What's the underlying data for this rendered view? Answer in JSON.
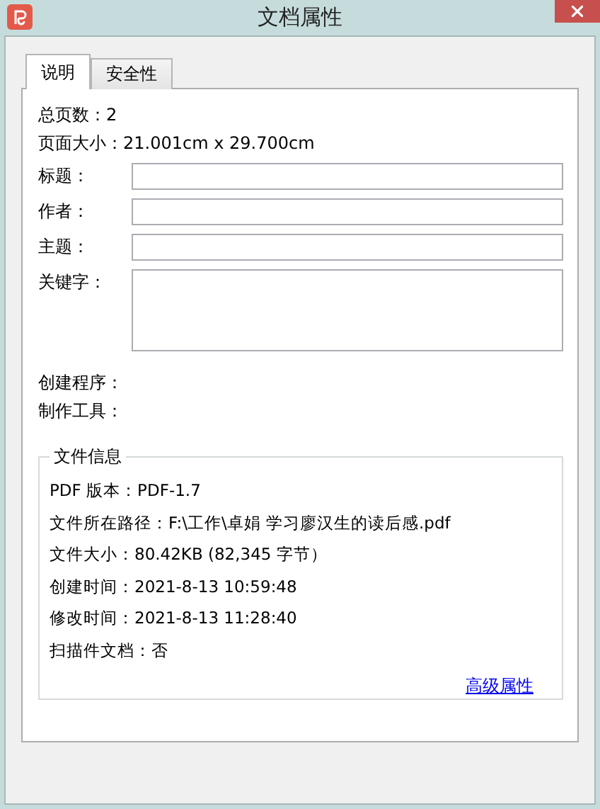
{
  "window": {
    "title": "文档属性"
  },
  "tabs": [
    {
      "label": "说明",
      "selected": true
    },
    {
      "label": "安全性",
      "selected": false
    }
  ],
  "summary": [
    "总页数：2",
    "页面大小：21.001cm x 29.700cm"
  ],
  "fields": [
    {
      "label": "标题：",
      "kind": "line"
    },
    {
      "label": "作者：",
      "kind": "line"
    },
    {
      "label": "主题：",
      "kind": "line"
    },
    {
      "label": "关键字：",
      "kind": "area"
    }
  ],
  "meta": [
    "创建程序：",
    "制作工具："
  ],
  "file_info": {
    "title": "文件信息",
    "lines": [
      "PDF 版本：PDF-1.7",
      "文件所在路径：F:\\工作\\卓娟 学习廖汉生的读后感.pdf",
      "文件大小：80.42KB (82,345 字节）",
      "创建时间：2021-8-13 10:59:48",
      "修改时间：2021-8-13 11:28:40",
      "扫描件文档：否"
    ],
    "link": "高级属性"
  }
}
